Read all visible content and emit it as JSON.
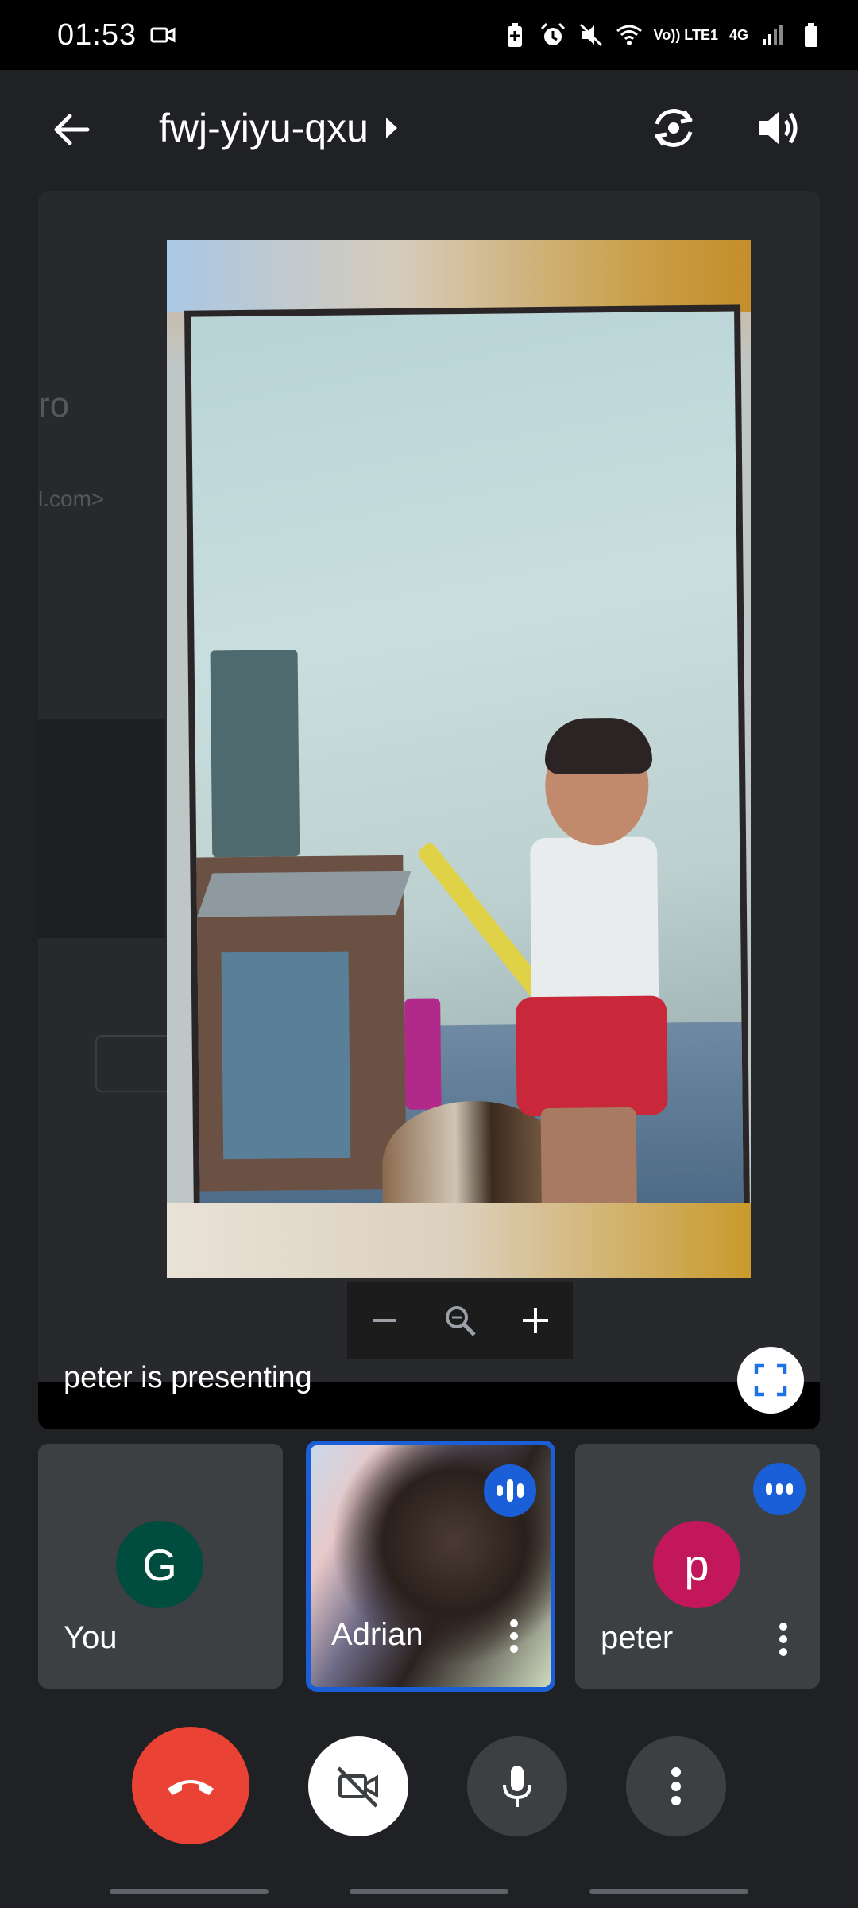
{
  "status_bar": {
    "time": "01:53",
    "volte_label": "Vo)) LTE1",
    "network_label": "4G"
  },
  "top_bar": {
    "meeting_code": "fwj-yiyu-qxu"
  },
  "background_app": {
    "text_1": "ro",
    "text_2": "l.com>"
  },
  "presentation": {
    "status_text": "peter is presenting"
  },
  "participants": [
    {
      "name": "You",
      "initial": "G",
      "avatar_color": "#004d40"
    },
    {
      "name": "Adrian",
      "speaking": true
    },
    {
      "name": "peter",
      "initial": "p",
      "avatar_color": "#c2185b",
      "speaking": true
    }
  ],
  "colors": {
    "end_call": "#ea4335",
    "active_speaker": "#1a5ed8"
  },
  "icons": [
    "video-camera-icon",
    "battery-saver-icon",
    "alarm-icon",
    "mute-icon",
    "wifi-icon",
    "signal-icon",
    "battery-icon",
    "back-arrow-icon",
    "switch-camera-icon",
    "speaker-icon",
    "zoom-out-icon",
    "zoom-icon",
    "zoom-in-icon",
    "fullscreen-icon",
    "audio-level-icon",
    "more-vert-icon",
    "end-call-icon",
    "camera-off-icon",
    "microphone-icon"
  ]
}
